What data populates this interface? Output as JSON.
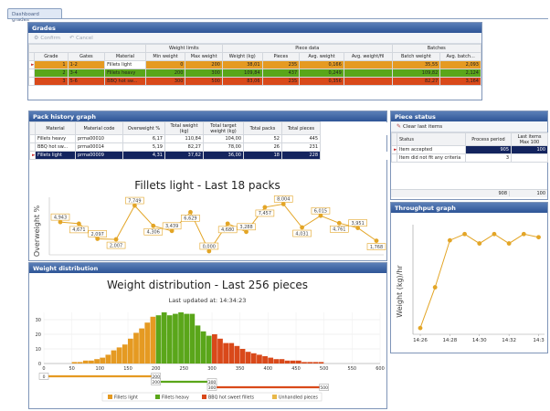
{
  "tab": {
    "label": "Dashboard grades"
  },
  "grades": {
    "title": "Grades",
    "toolbar": {
      "confirm": "Confirm",
      "cancel": "Cancel"
    },
    "group_headers": {
      "weight_limits": "Weight limits",
      "piece_data": "Piece data",
      "batches": "Batches"
    },
    "columns": [
      "Grade",
      "Gates",
      "Material",
      "Min weight",
      "Max weight",
      "Weight (kg)",
      "Pieces",
      "Avg. weight",
      "Avg. weight/fil",
      "Batch weight",
      "Avg. batch..."
    ],
    "rows": [
      {
        "grade": "1",
        "gates": "1-2",
        "material": "Fillets light",
        "min": "0",
        "max": "200",
        "weight": "38,01",
        "pieces": "235",
        "avg": "0,166",
        "avgfil": "",
        "batch": "35,55",
        "avgbatch": "2,093",
        "color": "#e59a22"
      },
      {
        "grade": "2",
        "gates": "3-4",
        "material": "Fillets heavy",
        "min": "200",
        "max": "300",
        "weight": "109,84",
        "pieces": "437",
        "avg": "0,249",
        "avgfil": "",
        "batch": "109,82",
        "avgbatch": "2,124",
        "color": "#5aa61a"
      },
      {
        "grade": "3",
        "gates": "5-6",
        "material": "BBQ hot sw...",
        "min": "300",
        "max": "500",
        "weight": "83,06",
        "pieces": "235",
        "avg": "0,356",
        "avgfil": "",
        "batch": "82,27",
        "avgbatch": "3,164",
        "color": "#d9491a"
      }
    ]
  },
  "pack_history": {
    "title": "Pack history graph",
    "columns": [
      "Material",
      "Material code",
      "Overweight %",
      "Total weight (kg)",
      "Total target weight (kg)",
      "Total packs",
      "Total pieces"
    ],
    "rows": [
      {
        "material": "Fillets heavy",
        "code": "prma00010",
        "over": "6,17",
        "total": "110,84",
        "target": "104,00",
        "packs": "52",
        "pieces": "445"
      },
      {
        "material": "BBQ hot sw...",
        "code": "prma00014",
        "over": "5,19",
        "total": "82,27",
        "target": "78,00",
        "packs": "26",
        "pieces": "231"
      },
      {
        "material": "Fillets light",
        "code": "prma00009",
        "over": "4,31",
        "total": "37,62",
        "target": "36,00",
        "packs": "18",
        "pieces": "228"
      }
    ]
  },
  "packs_chart": {
    "title": "Fillets light - Last 18 packs",
    "ylabel": "Overweight %",
    "labels": [
      "4,943",
      "4,671",
      "2,097",
      "2,007",
      "7,749",
      "4,306",
      "3,439",
      "6,629",
      "0,000",
      "4,680",
      "3,288",
      "7,457",
      "8,004",
      "4,031",
      "6,015",
      "4,761",
      "3,951",
      "1,768"
    ]
  },
  "piece_status": {
    "title": "Piece status",
    "toolbar": {
      "clear": "Clear last items"
    },
    "columns": [
      "Status",
      "Process period",
      "Last items Max 100"
    ],
    "rows": [
      {
        "status": "Item accepted",
        "period": "905",
        "last": "100"
      },
      {
        "status": "Item did not fit any criteria",
        "period": "3",
        "last": ""
      }
    ],
    "totals": {
      "period": "908",
      "last": "100"
    }
  },
  "throughput": {
    "title": "Throughput graph",
    "ylabel": "Weight (kg)/hr",
    "xticks": [
      "14:26",
      "14:28",
      "14:30",
      "14:32",
      "14:3"
    ]
  },
  "weight_dist": {
    "title": "Weight distribution",
    "chart_title": "Weight distribution - Last 256 pieces",
    "updated_label": "Last updated at: 14:34:23",
    "yticks": [
      "0",
      "10",
      "20",
      "30"
    ],
    "xticks": [
      "0",
      "50",
      "100",
      "150",
      "200",
      "250",
      "300",
      "350",
      "400",
      "450",
      "500",
      "550",
      "600"
    ],
    "range_labels": [
      "0",
      "200",
      "200",
      "300",
      "300",
      "500"
    ],
    "legend": [
      "Fillets light",
      "Fillets heavy",
      "BBQ hot sweet fillets",
      "Unhandled pieces"
    ],
    "colors": {
      "light": "#e59a22",
      "heavy": "#5aa61a",
      "bbq": "#d9491a",
      "unhandled": "#e8b84a"
    }
  },
  "chart_data": [
    {
      "type": "line",
      "title": "Fillets light - Last 18 packs",
      "ylabel": "Overweight %",
      "x": [
        1,
        2,
        3,
        4,
        5,
        6,
        7,
        8,
        9,
        10,
        11,
        12,
        13,
        14,
        15,
        16,
        17,
        18
      ],
      "series": [
        {
          "values": [
            4.943,
            4.671,
            2.097,
            2.007,
            7.749,
            4.306,
            3.439,
            6.629,
            0.0,
            4.68,
            3.288,
            7.457,
            8.004,
            4.031,
            6.015,
            4.761,
            3.951,
            1.768
          ]
        }
      ]
    },
    {
      "type": "line",
      "title": "",
      "ylabel": "Weight (kg)/hr",
      "x": [
        "14:26",
        "14:27",
        "14:28",
        "14:29",
        "14:30",
        "14:31",
        "14:32",
        "14:33",
        "14:34"
      ],
      "series": [
        {
          "values": [
            2,
            15,
            30,
            32,
            29,
            32,
            29,
            32,
            31
          ]
        }
      ]
    },
    {
      "type": "bar",
      "title": "Weight distribution - Last 256 pieces",
      "xlim": [
        0,
        600
      ],
      "ylim": [
        0,
        35
      ],
      "bins_start": [
        50,
        60,
        70,
        80,
        90,
        100,
        110,
        120,
        130,
        140,
        150,
        160,
        170,
        180,
        190,
        200,
        210,
        220,
        230,
        240,
        250,
        260,
        270,
        280,
        290,
        300,
        310,
        320,
        330,
        340,
        350,
        360,
        370,
        380,
        390,
        400,
        410,
        420,
        430,
        440,
        450,
        460,
        470,
        480,
        490
      ],
      "values": [
        1,
        1,
        2,
        2,
        3,
        4,
        6,
        9,
        11,
        13,
        17,
        21,
        24,
        28,
        32,
        33,
        35,
        33,
        34,
        35,
        34,
        34,
        26,
        22,
        19,
        20,
        17,
        14,
        14,
        12,
        10,
        8,
        7,
        6,
        5,
        4,
        3,
        3,
        2,
        2,
        2,
        1,
        1,
        1,
        1
      ]
    }
  ]
}
